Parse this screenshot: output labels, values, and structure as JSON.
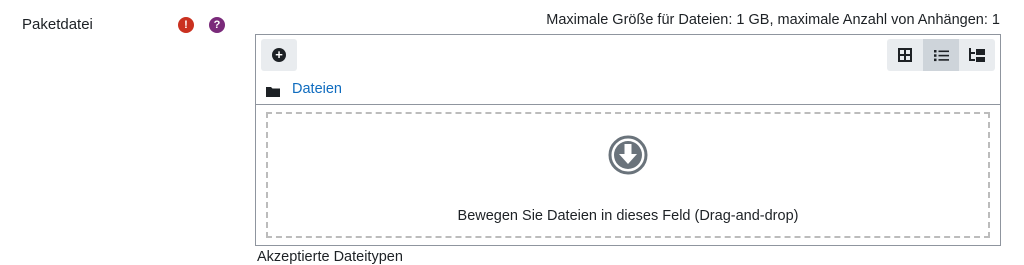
{
  "field": {
    "label": "Paketdatei",
    "required_icon": "exclamation-circle-icon",
    "help_icon": "question-circle-icon",
    "required_color": "#ca3120",
    "help_color": "#7a2a7a"
  },
  "limits_text": "Maximale Größe für Dateien: 1 GB, maximale Anzahl von Anhängen: 1",
  "filepicker": {
    "add_icon": "plus-circle-icon",
    "views": [
      {
        "name": "icons-view",
        "icon": "grid-icon",
        "active": false
      },
      {
        "name": "list-view",
        "icon": "list-icon",
        "active": true
      },
      {
        "name": "tree-view",
        "icon": "tree-icon",
        "active": false
      }
    ],
    "folder_icon": "folder-icon",
    "folder_label": "Dateien",
    "drop_icon": "arrow-circle-down-icon",
    "drop_text": "Bewegen Sie Dateien in dieses Feld (Drag-and-drop)"
  },
  "next_field_partial": "Akzeptierte Dateitypen",
  "colors": {
    "link": "#0f6cbf",
    "border": "#8f959e",
    "button_bg": "#e9ecef",
    "button_active_bg": "#ced4da"
  }
}
